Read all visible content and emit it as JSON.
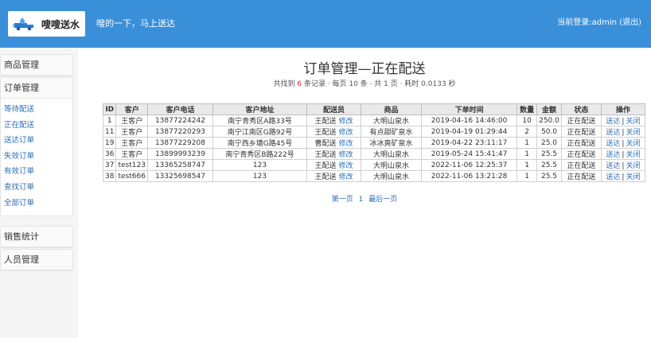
{
  "header": {
    "logo_text": "嗖嗖送水",
    "slogan": "嗖的一下，马上送达",
    "login_prefix": "当前登录:admin",
    "logout": "(退出)"
  },
  "sidebar": {
    "groups": [
      {
        "label": "商品管理"
      },
      {
        "label": "订单管理",
        "items": [
          "等待配送",
          "正在配送",
          "送达订单",
          "失效订单",
          "有效订单",
          "查找订单",
          "全部订单"
        ]
      },
      {
        "label": "销售统计"
      },
      {
        "label": "人员管理"
      }
    ]
  },
  "page": {
    "title": "订单管理—正在配送",
    "summary_prefix": "共找到",
    "summary_count": "6",
    "summary_suffix": "条记录 · 每页 10 条 · 共 1 页 · 耗时 0.0133 秒"
  },
  "table": {
    "headers": [
      "ID",
      "客户",
      "客户电话",
      "客户地址",
      "配送员",
      "商品",
      "下单时间",
      "数量",
      "金额",
      "状态",
      "操作"
    ],
    "rows": [
      {
        "id": "1",
        "customer": "王客户",
        "phone": "13877224242",
        "address": "南宁青秀区A路33号",
        "courier": "王配送",
        "edit": "修改",
        "product": "大明山泉水",
        "time": "2019-04-16 14:46:00",
        "qty": "10",
        "amount": "250.0",
        "status": "正在配送",
        "op1": "送达",
        "sep": "|",
        "op2": "关闭"
      },
      {
        "id": "11",
        "customer": "王客户",
        "phone": "13877220293",
        "address": "南宁江南区G路92号",
        "courier": "王配送",
        "edit": "修改",
        "product": "有点甜矿泉水",
        "time": "2019-04-19 01:29:44",
        "qty": "2",
        "amount": "50.0",
        "status": "正在配送",
        "op1": "送达",
        "sep": "|",
        "op2": "关闭"
      },
      {
        "id": "19",
        "customer": "王客户",
        "phone": "13877229208",
        "address": "南宁西乡塘G路45号",
        "courier": "曹配送",
        "edit": "修改",
        "product": "冰冰爽矿泉水",
        "time": "2019-04-22 23:11:17",
        "qty": "1",
        "amount": "25.0",
        "status": "正在配送",
        "op1": "送达",
        "sep": "|",
        "op2": "关闭"
      },
      {
        "id": "36",
        "customer": "王客户",
        "phone": "13899993239",
        "address": "南宁青秀区B路222号",
        "courier": "王配送",
        "edit": "修改",
        "product": "大明山泉水",
        "time": "2019-05-24 15:41:47",
        "qty": "1",
        "amount": "25.5",
        "status": "正在配送",
        "op1": "送达",
        "sep": "|",
        "op2": "关闭"
      },
      {
        "id": "37",
        "customer": "test123",
        "phone": "13365258747",
        "address": "123",
        "courier": "王配送",
        "edit": "修改",
        "product": "大明山泉水",
        "time": "2022-11-06 12:25:37",
        "qty": "1",
        "amount": "25.5",
        "status": "正在配送",
        "op1": "送达",
        "sep": "|",
        "op2": "关闭"
      },
      {
        "id": "38",
        "customer": "test666",
        "phone": "13325698547",
        "address": "123",
        "courier": "王配送",
        "edit": "修改",
        "product": "大明山泉水",
        "time": "2022-11-06 13:21:28",
        "qty": "1",
        "amount": "25.5",
        "status": "正在配送",
        "op1": "送达",
        "sep": "|",
        "op2": "关闭"
      }
    ]
  },
  "pager": {
    "first": "第一页",
    "current": "1",
    "last": "最后一页"
  },
  "colors": {
    "header_bg": "#3a8fd9",
    "link": "#2a6fb8",
    "count_red": "#e02020"
  },
  "icons": {
    "logo": "water-truck-icon"
  }
}
